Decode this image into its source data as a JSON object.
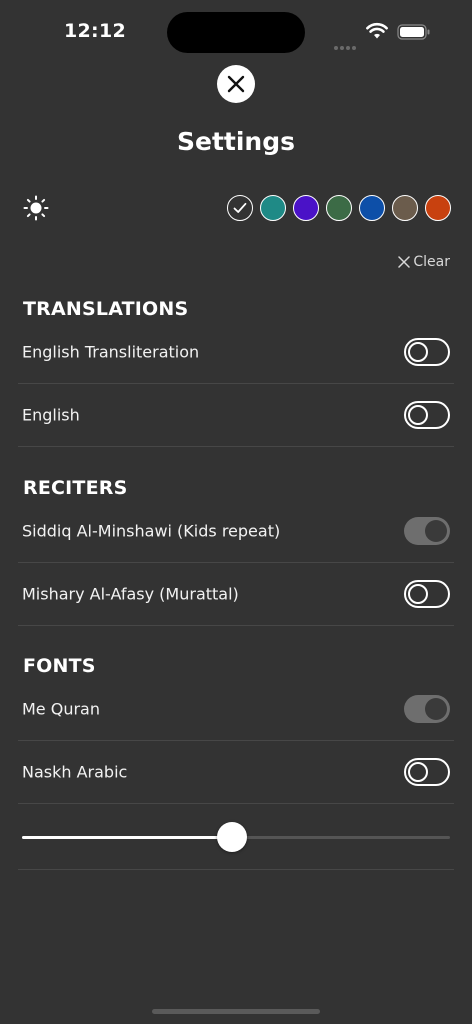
{
  "status_bar": {
    "time": "12:12"
  },
  "header": {
    "title": "Settings"
  },
  "theme": {
    "swatches": [
      {
        "color": "#333333",
        "selected": true
      },
      {
        "color": "#1f8a86",
        "selected": false
      },
      {
        "color": "#4a12c7",
        "selected": false
      },
      {
        "color": "#3c6b46",
        "selected": false
      },
      {
        "color": "#0d4fa8",
        "selected": false
      },
      {
        "color": "#6b5c4c",
        "selected": false
      },
      {
        "color": "#c8410f",
        "selected": false
      }
    ]
  },
  "clear_label": "Clear",
  "sections": {
    "translations": {
      "title": "TRANSLATIONS",
      "items": [
        {
          "label": "English Transliteration",
          "enabled": false
        },
        {
          "label": "English",
          "enabled": false
        }
      ]
    },
    "reciters": {
      "title": "RECITERS",
      "items": [
        {
          "label": "Siddiq Al-Minshawi (Kids repeat)",
          "enabled": true
        },
        {
          "label": "Mishary Al-Afasy (Murattal)",
          "enabled": false
        }
      ]
    },
    "fonts": {
      "title": "FONTS",
      "items": [
        {
          "label": "Me Quran",
          "enabled": true
        },
        {
          "label": "Naskh Arabic",
          "enabled": false
        }
      ]
    }
  },
  "font_size_slider": {
    "value_fraction": 0.49
  }
}
